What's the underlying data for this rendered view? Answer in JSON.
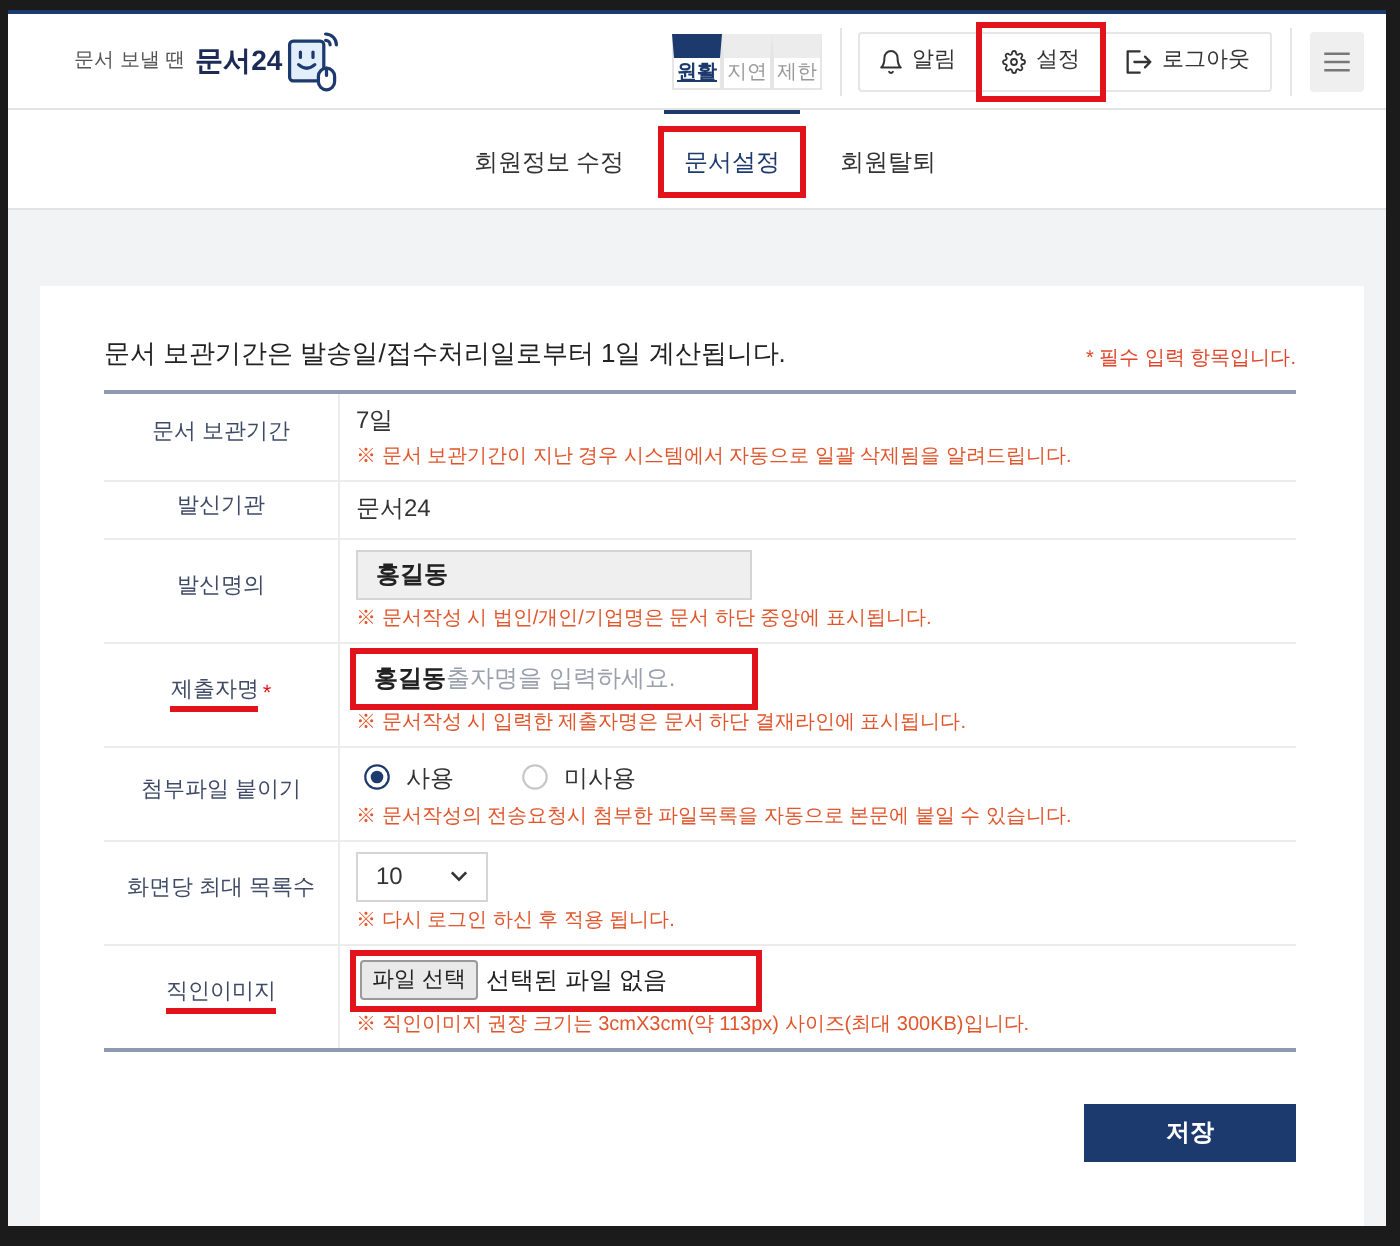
{
  "header": {
    "logo": {
      "tagline": "문서 보낼 땐",
      "name": "문서24"
    },
    "service_status": [
      {
        "label": "원활",
        "selected": true
      },
      {
        "label": "지연",
        "selected": false
      },
      {
        "label": "제한",
        "selected": false
      }
    ],
    "actions": [
      {
        "kind": "bell",
        "label": "알림",
        "highlighted": false
      },
      {
        "kind": "gear",
        "label": "설정",
        "highlighted": true
      },
      {
        "kind": "logout",
        "label": "로그아웃",
        "highlighted": false
      }
    ]
  },
  "tabs": [
    {
      "label": "회원정보 수정",
      "selected": false,
      "highlighted": false
    },
    {
      "label": "문서설정",
      "selected": true,
      "highlighted": true
    },
    {
      "label": "회원탈퇴",
      "selected": false,
      "highlighted": false
    }
  ],
  "form": {
    "title": "문서 보관기간은 발송일/접수처리일로부터 1일 계산됩니다.",
    "required_notice": "* 필수 입력 항목입니다.",
    "rows": [
      {
        "label": "문서 보관기간",
        "label_underlined": false,
        "kind": "text",
        "value": "7일",
        "note": "※ 문서 보관기간이 지난 경우 시스템에서 자동으로 일괄 삭제됨을 알려드립니다."
      },
      {
        "label": "발신기관",
        "label_underlined": false,
        "kind": "text",
        "value": "문서24"
      },
      {
        "label": "발신명의",
        "label_underlined": false,
        "kind": "input",
        "value": "홍길동",
        "readonly": true,
        "highlighted": false,
        "note": "※ 문서작성 시 법인/개인/기업명은 문서 하단 중앙에 표시됩니다."
      },
      {
        "label": "제출자명",
        "required_mark": "*",
        "label_underlined": true,
        "kind": "input",
        "value": "홍길동",
        "placeholder": "출자명을 입력하세요.",
        "readonly": false,
        "highlighted": true,
        "note": "※ 문서작성 시 입력한 제출자명은 문서 하단 결재라인에 표시됩니다."
      },
      {
        "label": "첨부파일 붙이기",
        "label_underlined": false,
        "kind": "radio",
        "options": [
          {
            "label": "사용",
            "selected": true
          },
          {
            "label": "미사용",
            "selected": false
          }
        ],
        "note": "※ 문서작성의 전송요청시 첨부한 파일목록을 자동으로 본문에 붙일 수 있습니다."
      },
      {
        "label": "화면당 최대 목록수",
        "label_underlined": false,
        "kind": "select",
        "value": "10",
        "note": "※ 다시 로그인 하신 후 적용 됩니다."
      },
      {
        "label": "직인이미지",
        "label_underlined": true,
        "kind": "file",
        "button": "파일 선택",
        "value": "선택된 파일 없음",
        "highlighted": true,
        "note": "※ 직인이미지 권장 크기는 3cmX3cm(약 113px) 사이즈(최대 300KB)입니다."
      }
    ]
  },
  "save_button": "저장"
}
